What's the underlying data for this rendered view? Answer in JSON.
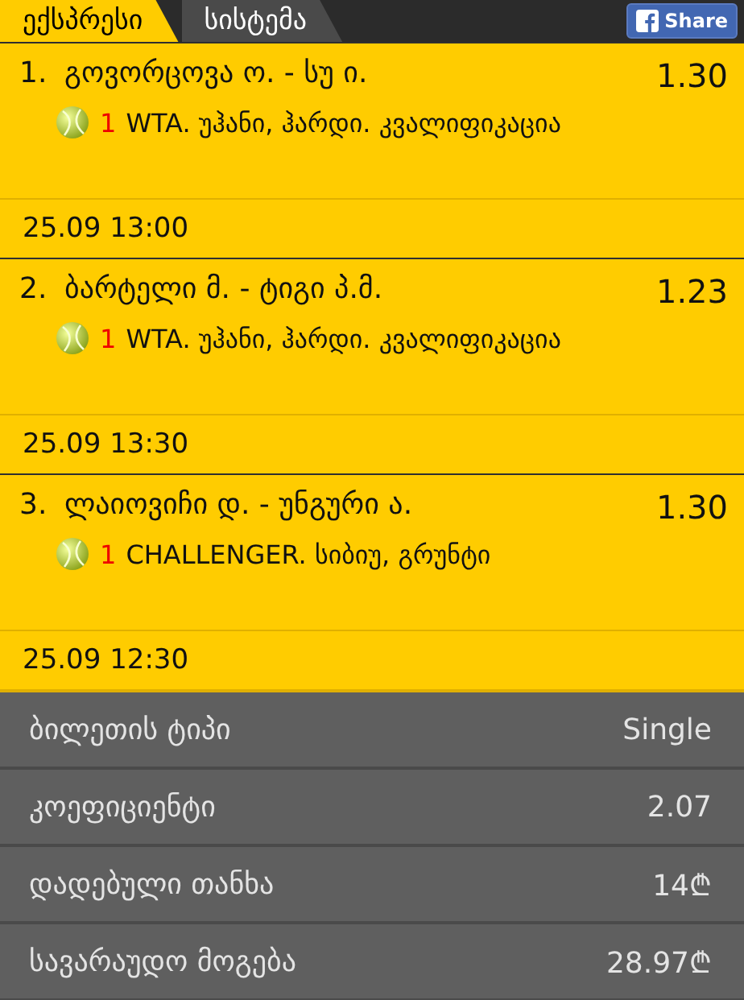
{
  "tabs": [
    {
      "label": "ექსპრესი",
      "selected": true
    },
    {
      "label": "სისტემა",
      "selected": false
    }
  ],
  "share_button": {
    "label": "Share"
  },
  "bets": [
    {
      "number": "1.",
      "match": "გოვორცოვა ო. - სუ ი.",
      "odds": "1.30",
      "pick": "1",
      "league": "WTA. უჰანი, ჰარდი. კვალიფიკაცია",
      "datetime": "25.09 13:00"
    },
    {
      "number": "2.",
      "match": "ბარტელი მ. - ტიგი პ.მ.",
      "odds": "1.23",
      "pick": "1",
      "league": "WTA. უჰანი, ჰარდი. კვალიფიკაცია",
      "datetime": "25.09 13:30"
    },
    {
      "number": "3.",
      "match": "ლაიოვიჩი დ. - უნგური ა.",
      "odds": "1.30",
      "pick": "1",
      "league": "CHALLENGER. სიბიუ, გრუნტი",
      "datetime": "25.09 12:30"
    }
  ],
  "summary": [
    {
      "label": "ბილეთის ტიპი",
      "value": "Single"
    },
    {
      "label": "კოეფიციენტი",
      "value": "2.07"
    },
    {
      "label": "დადებული თანხა",
      "value": "14₾"
    },
    {
      "label": "სავარაუდო მოგება",
      "value": "28.97₾"
    }
  ]
}
